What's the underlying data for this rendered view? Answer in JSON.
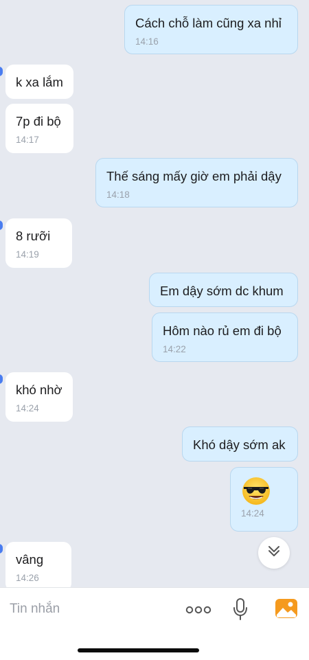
{
  "messages": [
    {
      "side": "out",
      "text": "Cách chỗ làm cũng xa nhỉ",
      "time": "14:16"
    },
    {
      "side": "in",
      "text": "k xa lắm",
      "time": ""
    },
    {
      "side": "in",
      "text": "7p đi bộ",
      "time": "14:17"
    },
    {
      "side": "out",
      "text": "Thế sáng mấy giờ em phải dậy",
      "time": "14:18"
    },
    {
      "side": "in",
      "text": "8 rưỡi",
      "time": "14:19"
    },
    {
      "side": "out",
      "text": "Em dậy sớm dc khum",
      "time": ""
    },
    {
      "side": "out",
      "text": "Hôm nào rủ em đi bộ",
      "time": "14:22"
    },
    {
      "side": "in",
      "text": "khó nhờ",
      "time": "14:24"
    },
    {
      "side": "out",
      "text": "Khó dậy sớm ak",
      "time": ""
    },
    {
      "side": "out",
      "emoji": "smiling-face-with-sunglasses",
      "time": "14:24"
    },
    {
      "side": "in",
      "text": "vâng",
      "time": "14:26"
    }
  ],
  "input": {
    "placeholder": "Tin nhắn"
  },
  "icons": {
    "scroll_down": "double-chevron-down-icon",
    "more": "more-dots-icon",
    "mic": "microphone-icon",
    "gallery": "image-gallery-icon"
  },
  "colors": {
    "background": "#e6e9f0",
    "incoming_bubble": "#ffffff",
    "outgoing_bubble": "#d9efff",
    "accent_orange": "#f59a1e"
  }
}
